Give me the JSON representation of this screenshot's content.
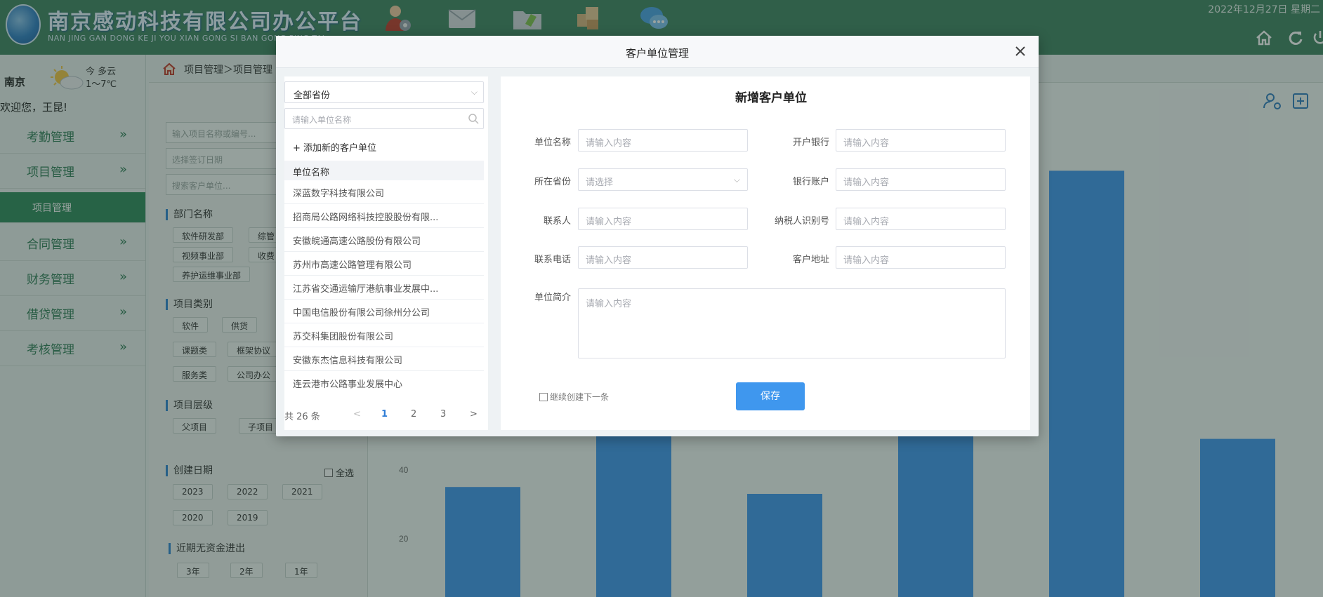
{
  "header": {
    "title": "南京感动科技有限公司办公平台",
    "subtitle": "NAN JING GAN DONG KE JI YOU XIAN GONG SI BAN GONG PING TAI",
    "date": "2022年12月27日 星期二"
  },
  "sidebar": {
    "city": "南京",
    "weather_text": "今 多云",
    "temp": "1～7℃",
    "welcome": "欢迎您，王昆!",
    "items": [
      {
        "label": "考勤管理"
      },
      {
        "label": "项目管理"
      },
      {
        "label": "项目管理"
      },
      {
        "label": "合同管理"
      },
      {
        "label": "财务管理"
      },
      {
        "label": "借贷管理"
      },
      {
        "label": "考核管理"
      }
    ],
    "chevron": "»"
  },
  "breadcrumb": "项目管理＞项目管理",
  "filter": {
    "project_search_placeholder": "输入项目名称或编号...",
    "sign_date_placeholder": "选择签订日期",
    "customer_search_placeholder": "搜索客户单位...",
    "dept_title": "部门名称",
    "dept_chips": [
      "软件研发部",
      "综管",
      "视频事业部",
      "收费",
      "养护运维事业部"
    ],
    "type_title": "项目类别",
    "type_chips": [
      "软件",
      "供货",
      "课题类",
      "框架协议",
      "服务类",
      "公司办公"
    ],
    "level_title": "项目层级",
    "level_chips": [
      "父项目",
      "子项目"
    ],
    "created_title": "创建日期",
    "select_all": "全选",
    "year_chips": [
      "2023",
      "2022",
      "2021",
      "2020",
      "2019"
    ],
    "nofund_title": "近期无资金进出",
    "nofund_chips": [
      "3年",
      "2年",
      "1年"
    ]
  },
  "chart_data": {
    "type": "bar",
    "y_ticks": [
      "40",
      "20"
    ],
    "ylim": [
      0,
      120
    ],
    "values": [
      32,
      75,
      30,
      54,
      124,
      46
    ],
    "color": "#3f97ee"
  },
  "modal": {
    "title": "客户单位管理",
    "province_filter": "全部省份",
    "unit_search_placeholder": "请输入单位名称",
    "add_new": "+ 添加新的客户单位",
    "list_header": "单位名称",
    "list_items": [
      "深蓝数字科技有限公司",
      "招商局公路网络科技控股股份有限...",
      "安徽皖通高速公路股份有限公司",
      "苏州市高速公路管理有限公司",
      "江苏省交通运输厅港航事业发展中...",
      "中国电信股份有限公司徐州分公司",
      "苏交科集团股份有限公司",
      "安徽东杰信息科技有限公司",
      "连云港市公路事业发展中心"
    ],
    "pager": {
      "total": "共 26 条",
      "prev": "<",
      "pages": [
        "1",
        "2",
        "3"
      ],
      "next": ">"
    },
    "form_title": "新增客户单位",
    "fields": {
      "unit_name": {
        "label": "单位名称",
        "placeholder": "请输入内容"
      },
      "bank": {
        "label": "开户银行",
        "placeholder": "请输入内容"
      },
      "province": {
        "label": "所在省份",
        "placeholder": "请选择"
      },
      "account": {
        "label": "银行账户",
        "placeholder": "请输入内容"
      },
      "contact": {
        "label": "联系人",
        "placeholder": "请输入内容"
      },
      "taxid": {
        "label": "纳税人识别号",
        "placeholder": "请输入内容"
      },
      "phone": {
        "label": "联系电话",
        "placeholder": "请输入内容"
      },
      "address": {
        "label": "客户地址",
        "placeholder": "请输入内容"
      },
      "intro": {
        "label": "单位简介",
        "placeholder": "请输入内容"
      }
    },
    "continue_label": "继续创建下一条",
    "save_label": "保存"
  }
}
